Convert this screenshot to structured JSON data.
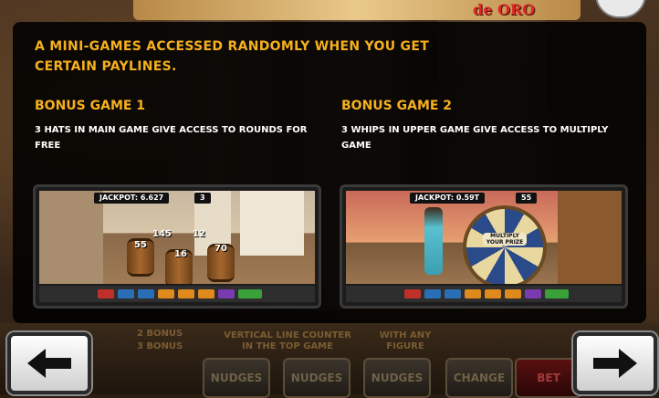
{
  "header": {
    "logo_text": "de ORO"
  },
  "help": {
    "intro": "A MINI-GAMES ACCESSED RANDOMLY WHEN YOU GET CERTAIN PAYLINES.",
    "bonus1": {
      "title": "BONUS GAME 1",
      "description": "3 HATS IN MAIN GAME GIVE ACCESS TO ROUNDS FOR FREE",
      "screenshot": {
        "jackpot": "JACKPOT: 6.627",
        "counter": "3",
        "numbers": [
          "55",
          "145",
          "12",
          "16",
          "70"
        ]
      }
    },
    "bonus2": {
      "title": "BONUS GAME 2",
      "description": "3 WHIPS IN UPPER GAME GIVE ACCESS TO MULTIPLY GAME",
      "screenshot": {
        "jackpot": "JACKPOT: 0.59T",
        "counter": "55",
        "wheel_label": "MULTIPLY YOUR PRIZE"
      }
    }
  },
  "background": {
    "counter_text": "VERTICAL LINE COUNTER IN THE TOP GAME",
    "figure_text": "WITH ANY FIGURE",
    "bonus_lines": [
      "2 BONUS",
      "3 BONUS"
    ],
    "buttons": [
      "NUDGES",
      "NUDGES",
      "NUDGES",
      "CHANGE",
      "BET"
    ]
  },
  "nav": {
    "prev_label": "previous page",
    "next_label": "next page"
  }
}
